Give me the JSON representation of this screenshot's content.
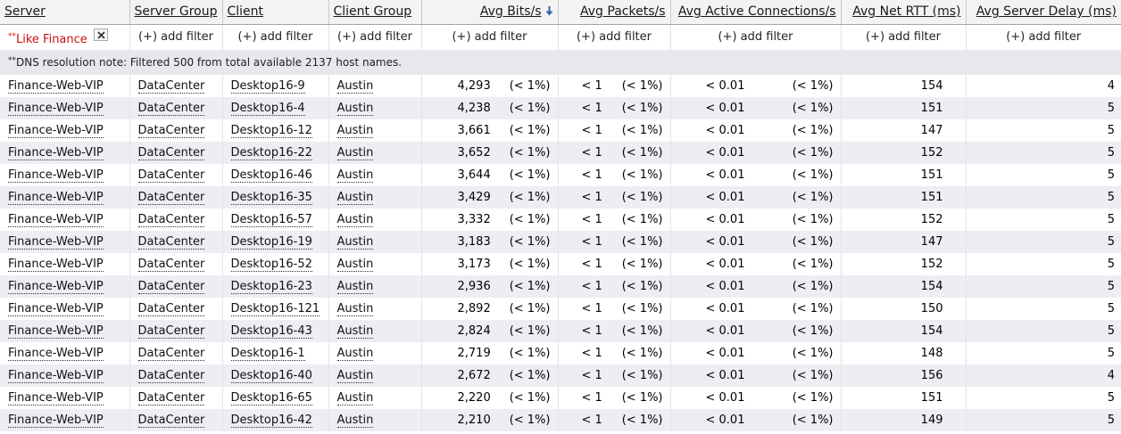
{
  "columns": [
    {
      "key": "server",
      "label": "Server"
    },
    {
      "key": "server_group",
      "label": "Server Group"
    },
    {
      "key": "client",
      "label": "Client"
    },
    {
      "key": "client_group",
      "label": "Client Group"
    },
    {
      "key": "avg_bits",
      "label": "Avg Bits/s",
      "sorted": "descending"
    },
    {
      "key": "avg_packets",
      "label": "Avg Packets/s"
    },
    {
      "key": "avg_active_conn",
      "label": "Avg Active Connections/s"
    },
    {
      "key": "avg_net_rtt",
      "label": "Avg Net RTT (ms)"
    },
    {
      "key": "avg_server_delay",
      "label": "Avg Server Delay (ms)"
    }
  ],
  "filters": {
    "server": {
      "prefix": "**",
      "text": "Like Finance"
    },
    "add_filter_label": "(+) add filter"
  },
  "note": {
    "prefix": "**",
    "text": "DNS resolution note: Filtered 500 from total available 2137 host names."
  },
  "colors": {
    "active_filter": "#cc1111",
    "alt_row": "#eceef4",
    "note_bg": "#e7e8ec"
  },
  "icons": {
    "sort": "arrow-down-icon",
    "remove_filter": "close-icon"
  },
  "rows": [
    {
      "server": "Finance-Web-VIP",
      "server_group": "DataCenter",
      "client": "Desktop16-9",
      "client_group": "Austin",
      "bits": "4,293",
      "bits_pct": "(< 1%)",
      "pkts": "< 1",
      "pkts_pct": "(< 1%)",
      "conn": "< 0.01",
      "conn_pct": "(< 1%)",
      "rtt": "154",
      "delay": "4"
    },
    {
      "server": "Finance-Web-VIP",
      "server_group": "DataCenter",
      "client": "Desktop16-4",
      "client_group": "Austin",
      "bits": "4,238",
      "bits_pct": "(< 1%)",
      "pkts": "< 1",
      "pkts_pct": "(< 1%)",
      "conn": "< 0.01",
      "conn_pct": "(< 1%)",
      "rtt": "151",
      "delay": "5"
    },
    {
      "server": "Finance-Web-VIP",
      "server_group": "DataCenter",
      "client": "Desktop16-12",
      "client_group": "Austin",
      "bits": "3,661",
      "bits_pct": "(< 1%)",
      "pkts": "< 1",
      "pkts_pct": "(< 1%)",
      "conn": "< 0.01",
      "conn_pct": "(< 1%)",
      "rtt": "147",
      "delay": "5"
    },
    {
      "server": "Finance-Web-VIP",
      "server_group": "DataCenter",
      "client": "Desktop16-22",
      "client_group": "Austin",
      "bits": "3,652",
      "bits_pct": "(< 1%)",
      "pkts": "< 1",
      "pkts_pct": "(< 1%)",
      "conn": "< 0.01",
      "conn_pct": "(< 1%)",
      "rtt": "152",
      "delay": "5"
    },
    {
      "server": "Finance-Web-VIP",
      "server_group": "DataCenter",
      "client": "Desktop16-46",
      "client_group": "Austin",
      "bits": "3,644",
      "bits_pct": "(< 1%)",
      "pkts": "< 1",
      "pkts_pct": "(< 1%)",
      "conn": "< 0.01",
      "conn_pct": "(< 1%)",
      "rtt": "151",
      "delay": "5"
    },
    {
      "server": "Finance-Web-VIP",
      "server_group": "DataCenter",
      "client": "Desktop16-35",
      "client_group": "Austin",
      "bits": "3,429",
      "bits_pct": "(< 1%)",
      "pkts": "< 1",
      "pkts_pct": "(< 1%)",
      "conn": "< 0.01",
      "conn_pct": "(< 1%)",
      "rtt": "151",
      "delay": "5"
    },
    {
      "server": "Finance-Web-VIP",
      "server_group": "DataCenter",
      "client": "Desktop16-57",
      "client_group": "Austin",
      "bits": "3,332",
      "bits_pct": "(< 1%)",
      "pkts": "< 1",
      "pkts_pct": "(< 1%)",
      "conn": "< 0.01",
      "conn_pct": "(< 1%)",
      "rtt": "152",
      "delay": "5"
    },
    {
      "server": "Finance-Web-VIP",
      "server_group": "DataCenter",
      "client": "Desktop16-19",
      "client_group": "Austin",
      "bits": "3,183",
      "bits_pct": "(< 1%)",
      "pkts": "< 1",
      "pkts_pct": "(< 1%)",
      "conn": "< 0.01",
      "conn_pct": "(< 1%)",
      "rtt": "147",
      "delay": "5"
    },
    {
      "server": "Finance-Web-VIP",
      "server_group": "DataCenter",
      "client": "Desktop16-52",
      "client_group": "Austin",
      "bits": "3,173",
      "bits_pct": "(< 1%)",
      "pkts": "< 1",
      "pkts_pct": "(< 1%)",
      "conn": "< 0.01",
      "conn_pct": "(< 1%)",
      "rtt": "152",
      "delay": "5"
    },
    {
      "server": "Finance-Web-VIP",
      "server_group": "DataCenter",
      "client": "Desktop16-23",
      "client_group": "Austin",
      "bits": "2,936",
      "bits_pct": "(< 1%)",
      "pkts": "< 1",
      "pkts_pct": "(< 1%)",
      "conn": "< 0.01",
      "conn_pct": "(< 1%)",
      "rtt": "154",
      "delay": "5"
    },
    {
      "server": "Finance-Web-VIP",
      "server_group": "DataCenter",
      "client": "Desktop16-121",
      "client_group": "Austin",
      "bits": "2,892",
      "bits_pct": "(< 1%)",
      "pkts": "< 1",
      "pkts_pct": "(< 1%)",
      "conn": "< 0.01",
      "conn_pct": "(< 1%)",
      "rtt": "150",
      "delay": "5"
    },
    {
      "server": "Finance-Web-VIP",
      "server_group": "DataCenter",
      "client": "Desktop16-43",
      "client_group": "Austin",
      "bits": "2,824",
      "bits_pct": "(< 1%)",
      "pkts": "< 1",
      "pkts_pct": "(< 1%)",
      "conn": "< 0.01",
      "conn_pct": "(< 1%)",
      "rtt": "154",
      "delay": "5"
    },
    {
      "server": "Finance-Web-VIP",
      "server_group": "DataCenter",
      "client": "Desktop16-1",
      "client_group": "Austin",
      "bits": "2,719",
      "bits_pct": "(< 1%)",
      "pkts": "< 1",
      "pkts_pct": "(< 1%)",
      "conn": "< 0.01",
      "conn_pct": "(< 1%)",
      "rtt": "148",
      "delay": "5"
    },
    {
      "server": "Finance-Web-VIP",
      "server_group": "DataCenter",
      "client": "Desktop16-40",
      "client_group": "Austin",
      "bits": "2,672",
      "bits_pct": "(< 1%)",
      "pkts": "< 1",
      "pkts_pct": "(< 1%)",
      "conn": "< 0.01",
      "conn_pct": "(< 1%)",
      "rtt": "156",
      "delay": "4"
    },
    {
      "server": "Finance-Web-VIP",
      "server_group": "DataCenter",
      "client": "Desktop16-65",
      "client_group": "Austin",
      "bits": "2,220",
      "bits_pct": "(< 1%)",
      "pkts": "< 1",
      "pkts_pct": "(< 1%)",
      "conn": "< 0.01",
      "conn_pct": "(< 1%)",
      "rtt": "151",
      "delay": "5"
    },
    {
      "server": "Finance-Web-VIP",
      "server_group": "DataCenter",
      "client": "Desktop16-42",
      "client_group": "Austin",
      "bits": "2,210",
      "bits_pct": "(< 1%)",
      "pkts": "< 1",
      "pkts_pct": "(< 1%)",
      "conn": "< 0.01",
      "conn_pct": "(< 1%)",
      "rtt": "149",
      "delay": "5"
    }
  ]
}
